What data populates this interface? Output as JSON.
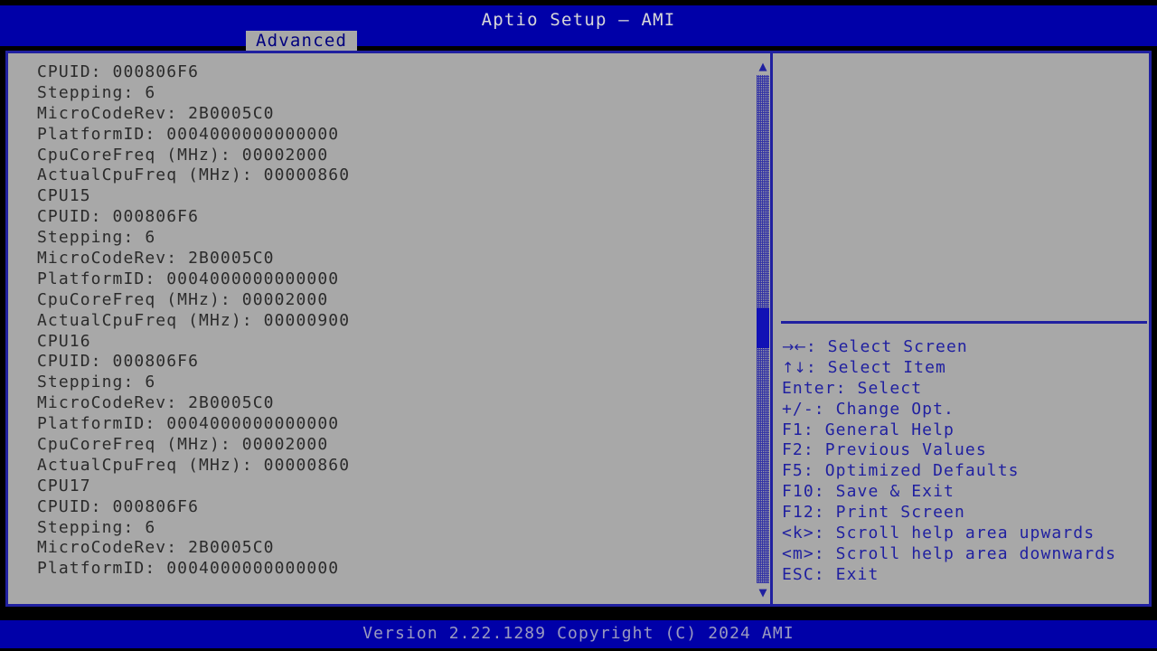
{
  "header": {
    "title": "Aptio Setup – AMI",
    "tabs": [
      {
        "label": "Advanced",
        "active": true
      }
    ]
  },
  "main": {
    "rows": [
      "CPUID: 000806F6",
      "Stepping: 6",
      "MicroCodeRev: 2B0005C0",
      "PlatformID: 0004000000000000",
      "CpuCoreFreq (MHz): 00002000",
      "ActualCpuFreq (MHz): 00000860",
      "CPU15",
      "CPUID: 000806F6",
      "Stepping: 6",
      "MicroCodeRev: 2B0005C0",
      "PlatformID: 0004000000000000",
      "CpuCoreFreq (MHz): 00002000",
      "ActualCpuFreq (MHz): 00000900",
      "CPU16",
      "CPUID: 000806F6",
      "Stepping: 6",
      "MicroCodeRev: 2B0005C0",
      "PlatformID: 0004000000000000",
      "CpuCoreFreq (MHz): 00002000",
      "ActualCpuFreq (MHz): 00000860",
      "CPU17",
      "CPUID: 000806F6",
      "Stepping: 6",
      "MicroCodeRev: 2B0005C0",
      "PlatformID: 0004000000000000"
    ]
  },
  "scrollbar": {
    "up_arrow": "▲",
    "down_arrow": "▼"
  },
  "help": {
    "rows": [
      {
        "glyph": "→←",
        "text": ": Select Screen"
      },
      {
        "glyph": "↑↓",
        "text": ": Select Item"
      },
      {
        "glyph": "",
        "text": "Enter: Select"
      },
      {
        "glyph": "",
        "text": "+/-: Change Opt."
      },
      {
        "glyph": "",
        "text": "F1: General Help"
      },
      {
        "glyph": "",
        "text": "F2: Previous Values"
      },
      {
        "glyph": "",
        "text": "F5: Optimized Defaults"
      },
      {
        "glyph": "",
        "text": "F10: Save & Exit"
      },
      {
        "glyph": "",
        "text": "F12: Print Screen"
      },
      {
        "glyph": "",
        "text": "<k>: Scroll help area upwards"
      },
      {
        "glyph": "",
        "text": "<m>: Scroll help area downwards"
      },
      {
        "glyph": "",
        "text": "ESC: Exit"
      }
    ]
  },
  "footer": {
    "version_text": "Version 2.22.1289 Copyright (C) 2024 AMI"
  },
  "colors": {
    "header_blue": "#0000a8",
    "panel_gray": "#a8a8a8",
    "border_blue": "#2020a0",
    "text_dark": "#2b2b2b",
    "help_text_blue": "#2020a0",
    "footer_text": "#9a9ac0",
    "scroll_thumb": "#1111b5"
  }
}
